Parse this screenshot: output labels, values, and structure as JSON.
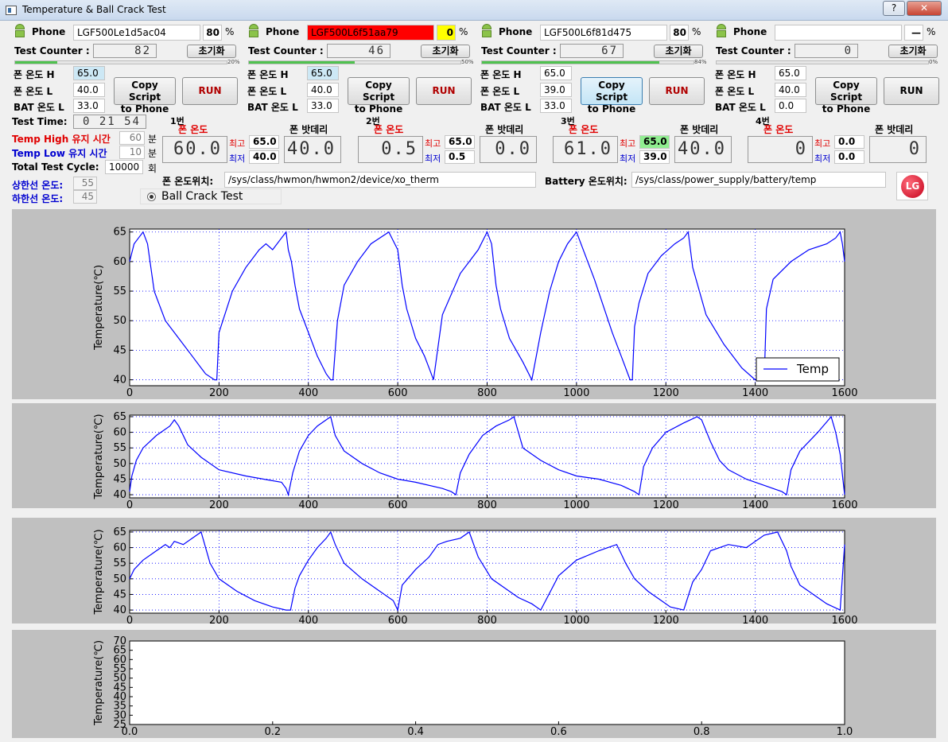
{
  "window": {
    "title": "Temperature & Ball Crack Test",
    "help_label": "?",
    "close_label": "✕"
  },
  "phones": [
    {
      "phone_label": "Phone",
      "name": "LGF500Le1d5ac04",
      "name_bg": "#ffffff",
      "pct_value": "80",
      "pct_bg": "#ffffff",
      "pct_unit": "%",
      "counter_label": "Test Counter :",
      "counter_value": "82",
      "reset_label": "초기화",
      "progress": 20,
      "progress_text": "20%",
      "temp_h_label": "폰 온도 H",
      "temp_h": "65.0",
      "temp_h_bg": "#cde8f5",
      "temp_l_label": "폰 온도 L",
      "temp_l": "40.0",
      "bat_l_label": "BAT 온도 L",
      "bat_l": "33.0",
      "copy_line1": "Copy Script",
      "copy_line2": "to Phone",
      "run_label": "RUN"
    },
    {
      "phone_label": "Phone",
      "name": "LGF500L6f51aa79",
      "name_bg": "#ff0000",
      "pct_value": "0",
      "pct_bg": "#ffff00",
      "pct_unit": "%",
      "counter_label": "Test Counter :",
      "counter_value": "46",
      "reset_label": "초기화",
      "progress": 50,
      "progress_text": "50%",
      "temp_h_label": "폰 온도 H",
      "temp_h": "65.0",
      "temp_h_bg": "#cde8f5",
      "temp_l_label": "폰 온도 L",
      "temp_l": "40.0",
      "bat_l_label": "BAT 온도 L",
      "bat_l": "33.0",
      "copy_line1": "Copy Script",
      "copy_line2": "to Phone",
      "run_label": "RUN"
    },
    {
      "phone_label": "Phone",
      "name": "LGF500L6f81d475",
      "name_bg": "#ffffff",
      "pct_value": "80",
      "pct_bg": "#ffffff",
      "pct_unit": "%",
      "counter_label": "Test Counter :",
      "counter_value": "67",
      "reset_label": "초기화",
      "progress": 84,
      "progress_text": "84%",
      "temp_h_label": "폰 온도 H",
      "temp_h": "65.0",
      "temp_h_bg": "#ffffff",
      "temp_l_label": "폰 온도 L",
      "temp_l": "39.0",
      "bat_l_label": "BAT 온도 L",
      "bat_l": "33.0",
      "copy_line1": "Copy Script",
      "copy_line2": "to Phone",
      "run_label": "RUN"
    },
    {
      "phone_label": "Phone",
      "name": "",
      "name_bg": "#ffffff",
      "pct_value": "—",
      "pct_bg": "#ffffff",
      "pct_unit": "%",
      "counter_label": "Test Counter :",
      "counter_value": "0",
      "reset_label": "초기화",
      "progress": 0,
      "progress_text": "0%",
      "temp_h_label": "폰 온도 H",
      "temp_h": "65.0",
      "temp_h_bg": "#ffffff",
      "temp_l_label": "폰 온도 L",
      "temp_l": "40.0",
      "bat_l_label": "BAT 온도 L",
      "bat_l": "0.0",
      "copy_line1": "Copy Script",
      "copy_line2": "to Phone",
      "run_label": "RUN"
    }
  ],
  "settings": {
    "test_time_label": "Test Time:",
    "test_time": "0 21 54",
    "temp_high_label": "Temp High 유지 시간",
    "temp_high_value": "60",
    "temp_high_unit": "분",
    "temp_low_label": "Temp Low 유지 시간",
    "temp_low_value": "10",
    "temp_low_unit": "분",
    "total_cycle_label": "Total Test Cycle:",
    "total_cycle_value": "10000",
    "total_cycle_unit": "회",
    "upper_limit_label": "상한선 온도:",
    "upper_limit_value": "55",
    "lower_limit_label": "하한선 온도:",
    "lower_limit_value": "45"
  },
  "temp_groups": [
    {
      "number": "1번",
      "phone_temp_label": "폰 온도",
      "battery_label": "폰 밧데리",
      "temp": "60.0",
      "max_label": "최고",
      "max": "65.0",
      "min_label": "최저",
      "min": "40.0",
      "battery": "40.0",
      "max_bg": "#ffffff"
    },
    {
      "number": "2번",
      "phone_temp_label": "폰 온도",
      "battery_label": "폰 밧데리",
      "temp": "0.5",
      "max_label": "최고",
      "max": "65.0",
      "min_label": "최저",
      "min": "0.5",
      "battery": "0.0",
      "max_bg": "#ffffff"
    },
    {
      "number": "3번",
      "phone_temp_label": "폰 온도",
      "battery_label": "폰 밧데리",
      "temp": "61.0",
      "max_label": "최고",
      "max": "65.0",
      "min_label": "최저",
      "min": "39.0",
      "battery": "40.0",
      "max_bg": "#90ee90"
    },
    {
      "number": "4번",
      "phone_temp_label": "폰 온도",
      "battery_label": "폰 밧데리",
      "temp": "0",
      "max_label": "최고",
      "max": "0.0",
      "min_label": "최저",
      "min": "0.0",
      "battery": "0",
      "max_bg": "#ffffff"
    }
  ],
  "paths": {
    "phone_path_label": "폰 온도위치:",
    "phone_path": "/sys/class/hwmon/hwmon2/device/xo_therm",
    "battery_path_label": "Battery 온도위치:",
    "battery_path": "/sys/class/power_supply/battery/temp"
  },
  "ball_crack_label": "Ball Crack Test",
  "logo_text": "LG",
  "colors": {
    "line": "#0000ff",
    "accent_red": "#e00000",
    "accent_blue": "#0000d0",
    "progress": "#4fc24f"
  },
  "chart_data": [
    {
      "type": "line",
      "title": "",
      "xlabel": "",
      "ylabel": "Temperature(℃)",
      "xlim": [
        0,
        1600
      ],
      "ylim": [
        39,
        65.5
      ],
      "xticks": [
        0,
        200,
        400,
        600,
        800,
        1000,
        1200,
        1400,
        1600
      ],
      "yticks": [
        40,
        45,
        50,
        55,
        60,
        65
      ],
      "grid": true,
      "legend": "lower-right",
      "series": [
        {
          "name": "Temp",
          "x": [
            0,
            10,
            20,
            30,
            40,
            55,
            80,
            110,
            140,
            170,
            190,
            195,
            200,
            230,
            260,
            290,
            305,
            320,
            340,
            350,
            355,
            362,
            370,
            380,
            400,
            420,
            440,
            450,
            455,
            465,
            480,
            510,
            540,
            580,
            600,
            610,
            620,
            640,
            660,
            670,
            680,
            700,
            740,
            780,
            800,
            810,
            820,
            830,
            850,
            880,
            900,
            920,
            940,
            960,
            980,
            1000,
            1040,
            1080,
            1100,
            1120,
            1125,
            1130,
            1140,
            1160,
            1190,
            1220,
            1240,
            1250,
            1260,
            1290,
            1330,
            1370,
            1400,
            1420,
            1425,
            1440,
            1480,
            1520,
            1560,
            1580,
            1590,
            1595,
            1600
          ],
          "values": [
            60,
            63,
            64,
            65,
            63,
            55,
            50,
            47,
            44,
            41,
            40,
            40,
            48,
            55,
            59,
            62,
            63,
            62,
            64,
            65,
            62,
            60,
            56,
            52,
            48,
            44,
            41,
            40,
            40,
            50,
            56,
            60,
            63,
            65,
            62,
            56,
            52,
            47,
            44,
            42,
            40,
            51,
            58,
            62,
            65,
            63,
            56,
            52,
            47,
            43,
            40,
            48,
            55,
            60,
            63,
            65,
            57,
            48,
            44,
            40,
            40,
            49,
            53,
            58,
            61,
            63,
            64,
            65,
            59,
            51,
            46,
            42,
            40,
            40,
            52,
            57,
            60,
            62,
            63,
            64,
            65,
            63,
            60
          ]
        }
      ]
    },
    {
      "type": "line",
      "title": "",
      "xlabel": "",
      "ylabel": "Temperature(℃)",
      "xlim": [
        0,
        1600
      ],
      "ylim": [
        39,
        65.5
      ],
      "xticks": [
        0,
        200,
        400,
        600,
        800,
        1000,
        1200,
        1400,
        1600
      ],
      "yticks": [
        40,
        45,
        50,
        55,
        60,
        65
      ],
      "grid": true,
      "legend": "none",
      "series": [
        {
          "name": "",
          "x": [
            0,
            5,
            15,
            30,
            60,
            90,
            100,
            110,
            130,
            160,
            200,
            260,
            300,
            340,
            350,
            355,
            365,
            380,
            400,
            420,
            440,
            450,
            460,
            480,
            520,
            560,
            600,
            640,
            700,
            720,
            730,
            740,
            760,
            790,
            820,
            850,
            860,
            880,
            920,
            960,
            1000,
            1050,
            1100,
            1130,
            1140,
            1150,
            1170,
            1200,
            1240,
            1270,
            1280,
            1300,
            1320,
            1340,
            1380,
            1420,
            1460,
            1470,
            1480,
            1500,
            1540,
            1570,
            1580,
            1590,
            1600
          ],
          "values": [
            41,
            46,
            51,
            55,
            59,
            62,
            64,
            62,
            56,
            52,
            48,
            46,
            45,
            44,
            42,
            40,
            47,
            54,
            59,
            62,
            64,
            65,
            59,
            54,
            50,
            47,
            45,
            44,
            42,
            41,
            40,
            47,
            53,
            59,
            62,
            64,
            65,
            55,
            51,
            48,
            46,
            45,
            43,
            41,
            40,
            49,
            55,
            60,
            63,
            65,
            64,
            57,
            51,
            48,
            45,
            43,
            41,
            40,
            48,
            54,
            60,
            65,
            60,
            53,
            40
          ]
        }
      ]
    },
    {
      "type": "line",
      "title": "",
      "xlabel": "",
      "ylabel": "Temperature(℃)",
      "xlim": [
        0,
        1600
      ],
      "ylim": [
        39,
        65.5
      ],
      "xticks": [
        0,
        200,
        400,
        600,
        800,
        1000,
        1200,
        1400,
        1600
      ],
      "yticks": [
        40,
        45,
        50,
        55,
        60,
        65
      ],
      "grid": true,
      "legend": "none",
      "series": [
        {
          "name": "",
          "x": [
            0,
            10,
            30,
            60,
            80,
            90,
            100,
            120,
            150,
            160,
            170,
            180,
            200,
            240,
            280,
            320,
            350,
            360,
            370,
            380,
            400,
            420,
            440,
            450,
            460,
            480,
            520,
            560,
            590,
            600,
            610,
            640,
            670,
            690,
            710,
            740,
            760,
            780,
            810,
            840,
            870,
            900,
            920,
            960,
            1000,
            1050,
            1090,
            1100,
            1110,
            1130,
            1160,
            1190,
            1210,
            1240,
            1260,
            1280,
            1290,
            1300,
            1340,
            1380,
            1420,
            1450,
            1470,
            1480,
            1500,
            1530,
            1560,
            1590,
            1600
          ],
          "values": [
            50,
            53,
            56,
            59,
            61,
            60,
            62,
            61,
            64,
            65,
            60,
            55,
            50,
            46,
            43,
            41,
            40,
            40,
            47,
            51,
            56,
            60,
            63,
            65,
            61,
            55,
            50,
            46,
            43,
            40,
            48,
            53,
            57,
            61,
            62,
            63,
            65,
            57,
            50,
            47,
            44,
            42,
            40,
            51,
            56,
            59,
            61,
            58,
            55,
            50,
            46,
            43,
            41,
            40,
            49,
            53,
            56,
            59,
            61,
            60,
            64,
            65,
            59,
            54,
            48,
            45,
            42,
            40,
            61
          ]
        }
      ]
    },
    {
      "type": "line",
      "title": "",
      "xlabel": "",
      "ylabel": "Temperature(℃)",
      "xlim": [
        0,
        1.0
      ],
      "ylim": [
        25,
        70
      ],
      "xticks": [
        0.0,
        0.2,
        0.4,
        0.6,
        0.8,
        1.0
      ],
      "yticks": [
        25,
        30,
        35,
        40,
        45,
        50,
        55,
        60,
        65,
        70
      ],
      "grid": false,
      "legend": "none",
      "series": []
    }
  ]
}
